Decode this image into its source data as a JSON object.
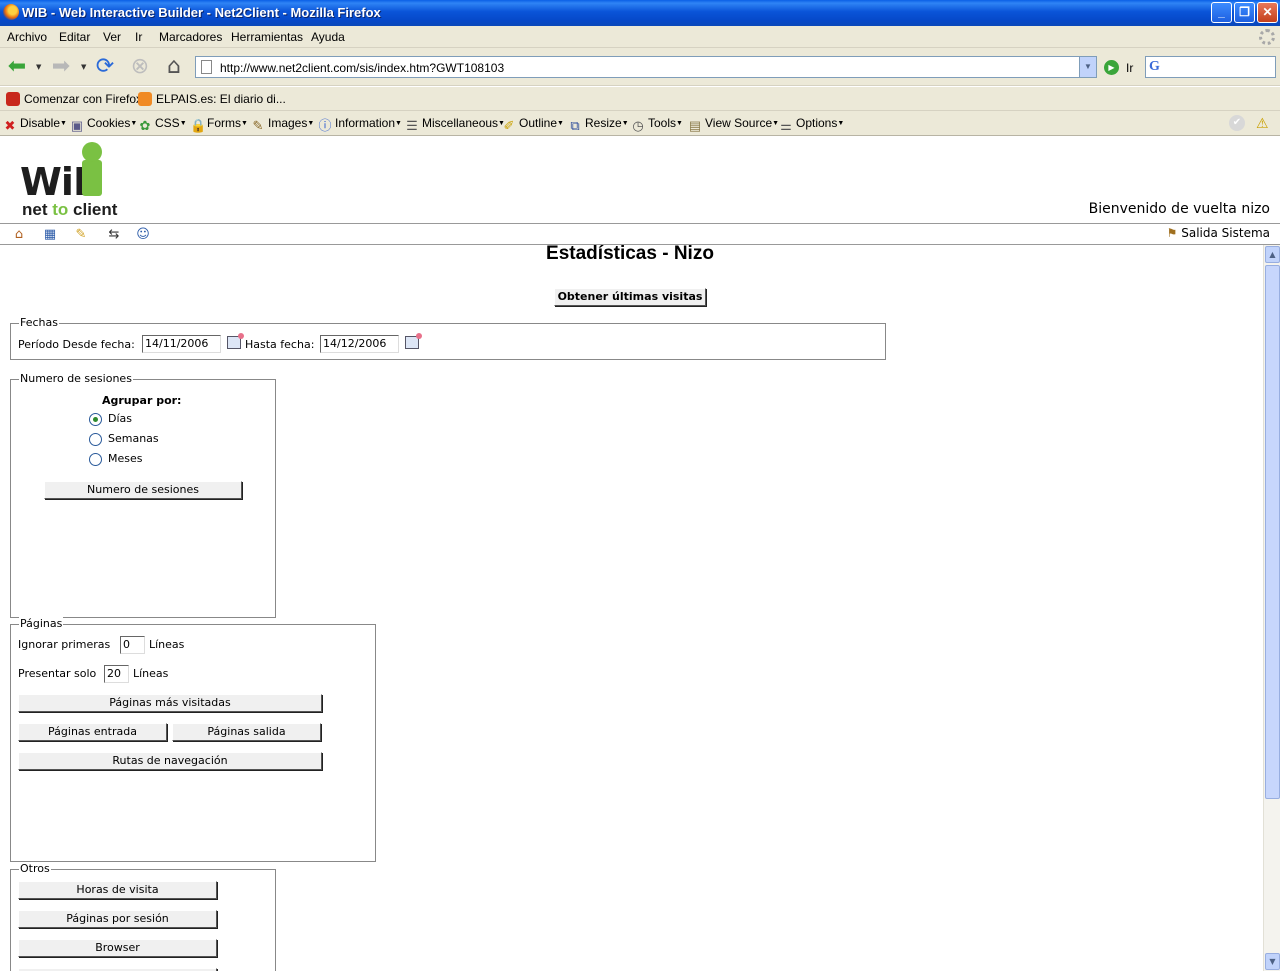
{
  "window": {
    "title": "WIB - Web Interactive Builder - Net2Client - Mozilla Firefox"
  },
  "menu": [
    "Archivo",
    "Editar",
    "Ver",
    "Ir",
    "Marcadores",
    "Herramientas",
    "Ayuda"
  ],
  "nav": {
    "url": "http://www.net2client.com/sis/index.htm?GWT108103",
    "go_label": "Ir",
    "search_engine_glyph": "G"
  },
  "bookmarks": [
    "Comenzar con Firefox",
    "ELPAIS.es: El diario di..."
  ],
  "devtoolbar": [
    "Disable",
    "Cookies",
    "CSS",
    "Forms",
    "Images",
    "Information",
    "Miscellaneous",
    "Outline",
    "Resize",
    "Tools",
    "View Source",
    "Options"
  ],
  "page": {
    "logo": {
      "mark": "WiB",
      "tag_net": "net",
      "tag_to": "to",
      "tag_client": "client"
    },
    "welcome": "Bienvenido de vuelta nizo",
    "logout": "Salida Sistema",
    "title": "Estadísticas - Nizo",
    "latest_visits_button": "Obtener últimas visitas",
    "fechas": {
      "legend": "Fechas",
      "from_label": "Período Desde fecha:",
      "from_value": "14/11/2006",
      "to_label": "Hasta fecha:",
      "to_value": "14/12/2006"
    },
    "sesiones": {
      "legend": "Numero de sesiones",
      "group_label": "Agrupar por:",
      "options": [
        "Días",
        "Semanas",
        "Meses"
      ],
      "selected": "Días",
      "button": "Numero de sesiones"
    },
    "paginas": {
      "legend": "Páginas",
      "ignore_label": "Ignorar primeras",
      "ignore_value": "0",
      "ignore_unit": "Líneas",
      "show_label": "Presentar solo",
      "show_value": "20",
      "show_unit": "Líneas",
      "btn_most_visited": "Páginas más visitadas",
      "btn_entry": "Páginas entrada",
      "btn_exit": "Páginas salida",
      "btn_routes": "Rutas de navegación"
    },
    "otros": {
      "legend": "Otros",
      "btn_hours": "Horas de visita",
      "btn_pages_per_session": "Páginas por sesión",
      "btn_browser": "Browser"
    }
  },
  "colors": {
    "titlebar": "#0a54d8",
    "chrome": "#ece9d8",
    "logo_green": "#7ac143"
  }
}
